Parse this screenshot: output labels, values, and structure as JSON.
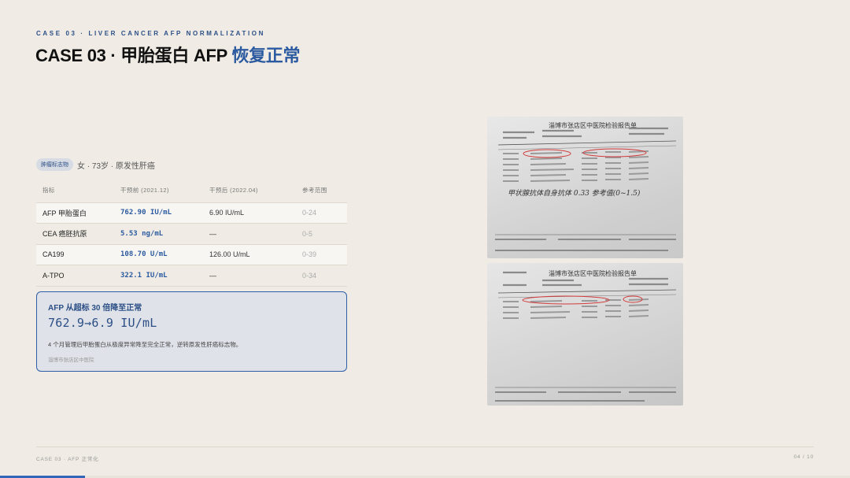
{
  "header": {
    "eyebrow": "CASE 03 · LIVER CANCER AFP NORMALIZATION",
    "title_main": "CASE 03 · 甲胎蛋白 AFP ",
    "title_accent": "恢复正常"
  },
  "patient": {
    "tag": "肿瘤标志物",
    "info": "女 · 73岁 · 原发性肝癌"
  },
  "table": {
    "headers": [
      "指标",
      "干预前 (2021.12)",
      "干预后 (2022.04)",
      "参考范围"
    ],
    "rows": [
      {
        "name": "AFP 甲胎蛋白",
        "pre": "762.90 IU/mL",
        "post": "6.90 IU/mL",
        "ref": "0-24"
      },
      {
        "name": "CEA 癌胚抗原",
        "pre": "5.53 ng/mL",
        "post": "—",
        "ref": "0-5"
      },
      {
        "name": "CA199",
        "pre": "108.70 U/mL",
        "post": "126.00 U/mL",
        "ref": "0-39"
      },
      {
        "name": "A-TPO",
        "pre": "322.1 IU/mL",
        "post": "—",
        "ref": "0-34"
      }
    ]
  },
  "highlight": {
    "label": "AFP 从超标 30 倍降至正常",
    "value": "762.9→6.9 IU/mL",
    "description": "4 个月管理后甲胎蛋白从极度异常降至完全正常，逆转原发性肝癌标志物。",
    "source": "淄博市张店区中医院"
  },
  "reports": [
    {
      "title": "淄博市张店区中医院检验报告单",
      "note": "甲状腺抗体自身抗体  0.33  参考值(0~1.5)"
    },
    {
      "title": "淄博市张店区中医院检验报告单",
      "note": ""
    }
  ],
  "footer": {
    "left": "CASE 03 · AFP 正常化",
    "right": "04 / 10",
    "progress": 0.1
  },
  "colors": {
    "accent": "#2b5aa0",
    "background": "#f0ece5"
  }
}
